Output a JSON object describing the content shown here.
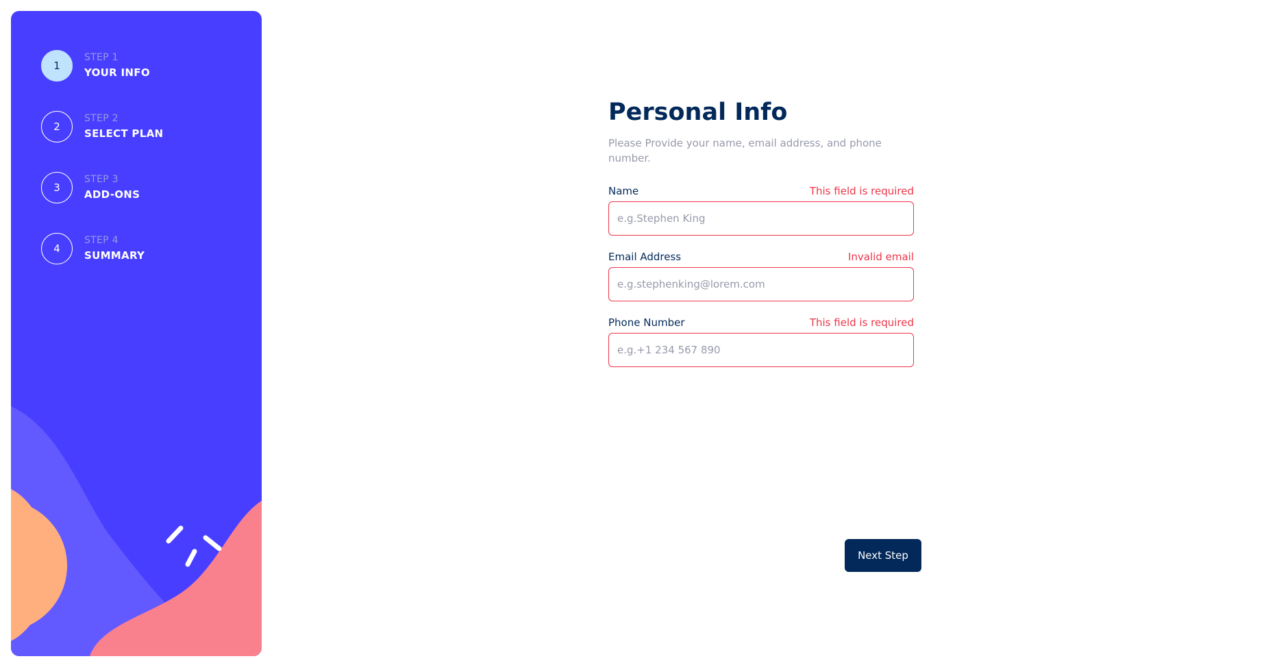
{
  "sidebar": {
    "steps": [
      {
        "number": "1",
        "sub": "STEP 1",
        "title": "YOUR INFO",
        "active": true
      },
      {
        "number": "2",
        "sub": "STEP 2",
        "title": "SELECT PLAN",
        "active": false
      },
      {
        "number": "3",
        "sub": "STEP 3",
        "title": "ADD-ONS",
        "active": false
      },
      {
        "number": "4",
        "sub": "STEP 4",
        "title": "SUMMARY",
        "active": false
      }
    ]
  },
  "main": {
    "title": "Personal Info",
    "subtitle": "Please Provide your name, email address, and phone number.",
    "fields": [
      {
        "label": "Name",
        "error": "This field is required",
        "value": "",
        "placeholder": "e.g.Stephen King"
      },
      {
        "label": "Email Address",
        "error": "Invalid email",
        "value": "",
        "placeholder": "e.g.stephenking@lorem.com"
      },
      {
        "label": "Phone Number",
        "error": "This field is required",
        "value": "",
        "placeholder": "e.g.+1 234 567 890"
      }
    ],
    "next_label": "Next Step"
  },
  "colors": {
    "sidebar_bg": "#483eff",
    "active_step": "#bfe2fd",
    "title": "#02295a",
    "error": "#ed3548",
    "button_bg": "#02295a"
  }
}
